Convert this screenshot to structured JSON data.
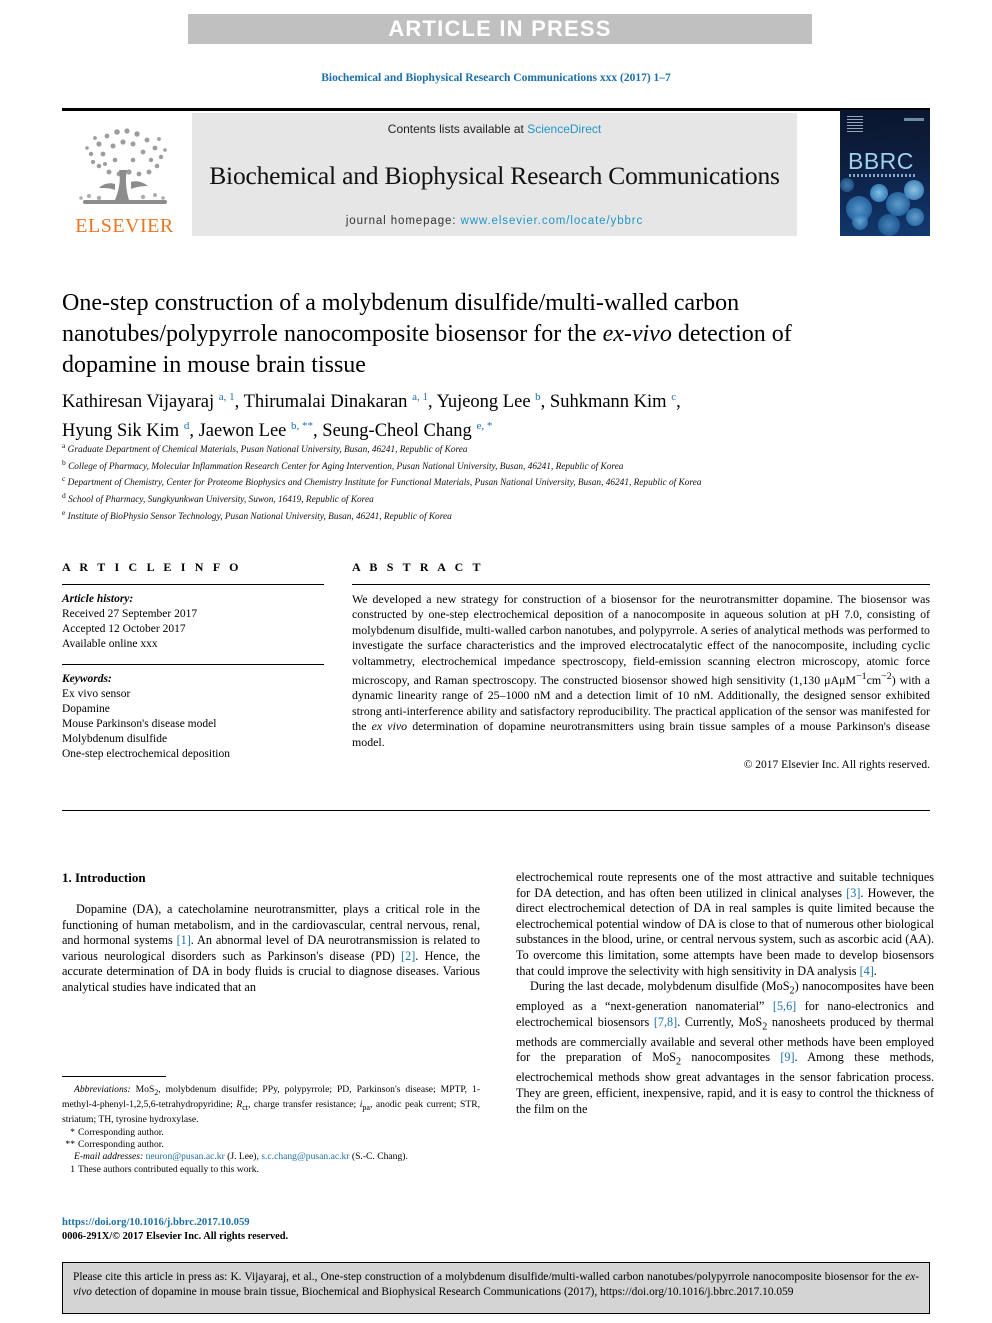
{
  "banner": {
    "text": "ARTICLE IN PRESS"
  },
  "running_citation": "Biochemical and Biophysical Research Communications xxx (2017) 1–7",
  "masthead": {
    "contents_prefix": "Contents lists available at ",
    "sciencedirect": "ScienceDirect",
    "journal_title": "Biochemical and Biophysical Research Communications",
    "homepage_prefix": "journal homepage: ",
    "homepage_url": "www.elsevier.com/locate/ybbrc",
    "publisher_wordmark": "ELSEVIER",
    "cover_wordmark": "BBRC"
  },
  "article": {
    "title_part1": "One-step construction of a molybdenum disulfide/multi-walled carbon nanotubes/polypyrrole nanocomposite biosensor for the ",
    "title_italic": "ex-vivo",
    "title_part2": " detection of dopamine in mouse brain tissue",
    "authors_line1_a": "Kathiresan Vijayaraj ",
    "authors_line1_sup1": "a, 1",
    "authors_line1_b": ", Thirumalai Dinakaran ",
    "authors_line1_sup2": "a, 1",
    "authors_line1_c": ", Yujeong Lee ",
    "authors_line1_sup3": "b",
    "authors_line1_d": ", Suhkmann Kim ",
    "authors_line1_sup4": "c",
    "authors_line1_e": ",",
    "authors_line2_a": "Hyung Sik Kim ",
    "authors_line2_sup1": "d",
    "authors_line2_b": ", Jaewon Lee ",
    "authors_line2_sup2": "b, **",
    "authors_line2_c": ", Seung-Cheol Chang ",
    "authors_line2_sup3": "e, *",
    "affiliations": [
      {
        "mark": "a",
        "text": "Graduate Department of Chemical Materials, Pusan National University, Busan, 46241, Republic of Korea"
      },
      {
        "mark": "b",
        "text": "College of Pharmacy, Molecular Inflammation Research Center for Aging Intervention, Pusan National University, Busan, 46241, Republic of Korea"
      },
      {
        "mark": "c",
        "text": "Department of Chemistry, Center for Proteome Biophysics and Chemistry Institute for Functional Materials, Pusan National University, Busan, 46241, Republic of Korea"
      },
      {
        "mark": "d",
        "text": "School of Pharmacy, Sungkyunkwan University, Suwon, 16419, Republic of Korea"
      },
      {
        "mark": "e",
        "text": "Institute of BioPhysio Sensor Technology, Pusan National University, Busan, 46241, Republic of Korea"
      }
    ]
  },
  "article_info": {
    "heading": "A R T I C L E   I N F O",
    "history_label": "Article history:",
    "history": [
      "Received 27 September 2017",
      "Accepted 12 October 2017",
      "Available online xxx"
    ],
    "keywords_label": "Keywords:",
    "keywords": [
      "Ex vivo sensor",
      "Dopamine",
      "Mouse Parkinson's disease model",
      "Molybdenum disulfide",
      "One-step electrochemical deposition"
    ]
  },
  "abstract": {
    "heading": "A B S T R A C T",
    "para_a": "We developed a new strategy for construction of a biosensor for the neurotransmitter dopamine. The biosensor was constructed by one-step electrochemical deposition of a nanocomposite in aqueous solution at pH 7.0, consisting of molybdenum disulfide, multi-walled carbon nanotubes, and polypyrrole. A series of analytical methods was performed to investigate the surface characteristics and the improved electrocatalytic effect of the nanocomposite, including cyclic voltammetry, electrochemical impedance spectroscopy, field-emission scanning electron microscopy, atomic force microscopy, and Raman spectroscopy. The constructed biosensor showed high sensitivity (1,130 ",
    "sensitivity_unit": "μAμM",
    "sensitivity_sup1": "−1",
    "sensitivity_cm": "cm",
    "sensitivity_sup2": "−2",
    "para_b": ") with a dynamic linearity range of 25–1000 nM and a detection limit of 10 nM. Additionally, the designed sensor exhibited strong anti-interference ability and satisfactory reproducibility. The practical application of the sensor was manifested for the ",
    "para_italic": "ex vivo",
    "para_c": " determination of dopamine neurotransmitters using brain tissue samples of a mouse Parkinson's disease model.",
    "copyright": "© 2017 Elsevier Inc. All rights reserved."
  },
  "body": {
    "section_heading": "1. Introduction",
    "left_p1_a": "Dopamine (DA), a catecholamine neurotransmitter, plays a critical role in the functioning of human metabolism, and in the cardiovascular, central nervous, renal, and hormonal systems ",
    "left_p1_ref1": "[1]",
    "left_p1_b": ". An abnormal level of DA neurotransmission is related to various neurological disorders such as Parkinson's disease (PD) ",
    "left_p1_ref2": "[2]",
    "left_p1_c": ". Hence, the accurate determination of DA in body fluids is crucial to diagnose diseases. Various analytical studies have indicated that an",
    "right_p1_a": "electrochemical route represents one of the most attractive and suitable techniques for DA detection, and has often been utilized in clinical analyses ",
    "right_p1_ref1": "[3]",
    "right_p1_b": ". However, the direct electrochemical detection of DA in real samples is quite limited because the electrochemical potential window of DA is close to that of numerous other biological substances in the blood, urine, or central nervous system, such as ascorbic acid (AA). To overcome this limitation, some attempts have been made to develop biosensors that could improve the selectivity with high sensitivity in DA analysis ",
    "right_p1_ref2": "[4]",
    "right_p1_c": ".",
    "right_p2_a": "During the last decade, molybdenum disulfide (MoS",
    "right_p2_sub1": "2",
    "right_p2_b": ") nanocomposites have been employed as a “next-generation nanomaterial” ",
    "right_p2_ref1": "[5,6]",
    "right_p2_c": " for nano-electronics and electrochemical biosensors ",
    "right_p2_ref2": "[7,8]",
    "right_p2_d": ". Currently, MoS",
    "right_p2_sub2": "2",
    "right_p2_e": " nanosheets produced by thermal methods are commercially available and several other methods have been employed for the preparation of MoS",
    "right_p2_sub3": "2",
    "right_p2_f": " nanocomposites ",
    "right_p2_ref3": "[9]",
    "right_p2_g": ". Among these methods, electrochemical methods show great advantages in the sensor fabrication process. They are green, efficient, inexpensive, rapid, and it is easy to control the thickness of the film on the"
  },
  "footnotes": {
    "abbrev_label": "Abbreviations:",
    "abbrev_a": " MoS",
    "abbrev_sub": "2",
    "abbrev_b": ", molybdenum disulfide; PPy, polypyrrole; PD, Parkinson's disease; MPTP, 1-methyl-4-phenyl-1,2,5,6-tetrahydropyridine; ",
    "abbrev_rct": "R",
    "abbrev_rct_sub": "ct",
    "abbrev_c": ", charge transfer resistance; ",
    "abbrev_ipa": "i",
    "abbrev_ipa_sub": "pa",
    "abbrev_d": ", anodic peak current; STR, striatum; TH, tyrosine hydroxylase.",
    "corr1_mark": "*",
    "corr1_text": "Corresponding author.",
    "corr2_mark": "**",
    "corr2_text": "Corresponding author.",
    "email_label": "E-mail addresses:",
    "email1": "neuron@pusan.ac.kr",
    "email1_who": " (J. Lee), ",
    "email2": "s.c.chang@pusan.ac.kr",
    "email2_who": " (S.-C. Chang).",
    "equal_mark": "1",
    "equal_text": "These authors contributed equally to this work.",
    "doi": "https://doi.org/10.1016/j.bbrc.2017.10.059",
    "issn": "0006-291X/© 2017 Elsevier Inc. All rights reserved."
  },
  "cite_box": {
    "part_a": "Please cite this article in press as: K. Vijayaraj, et al., One-step construction of a molybdenum disulfide/multi-walled carbon nanotubes/polypyrrole nanocomposite biosensor for the ",
    "italic": "ex-vivo",
    "part_b": " detection of dopamine in mouse brain tissue, Biochemical and Biophysical Research Communications (2017), https://doi.org/10.1016/j.bbrc.2017.10.059"
  },
  "colors": {
    "link_blue": "#1a6fa8",
    "sciencedirect_blue": "#2196c4",
    "elsevier_orange": "#e87722",
    "banner_gray": "#c0c0c0",
    "masthead_gray": "#e6e6e6",
    "citebox_gray": "#d4d4d4"
  }
}
